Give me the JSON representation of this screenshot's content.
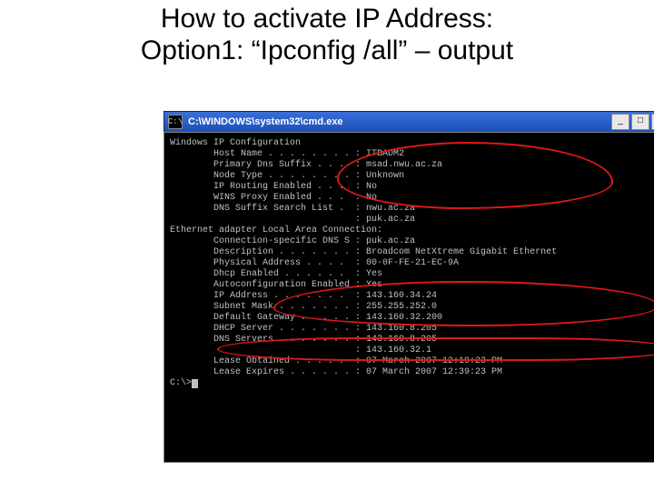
{
  "slide": {
    "title_line1": "How to activate IP Address:",
    "title_line2": "Option1: “Ipconfig /all” – output"
  },
  "window": {
    "icon_glyph": "C:\\",
    "title": "C:\\WINDOWS\\system32\\cmd.exe",
    "btn_min": "_",
    "btn_max": "□",
    "btn_close": "×"
  },
  "cmd": {
    "header": "Windows IP Configuration",
    "cfg": [
      {
        "label": "Host Name",
        "value": "ITBADM2"
      },
      {
        "label": "Primary Dns Suffix",
        "value": "msad.nwu.ac.za"
      },
      {
        "label": "Node Type",
        "value": "Unknown"
      },
      {
        "label": "IP Routing Enabled",
        "value": "No"
      },
      {
        "label": "WINS Proxy Enabled",
        "value": "No"
      },
      {
        "label": "DNS Suffix Search List",
        "value": "nwu.ac.za"
      },
      {
        "label": "",
        "value": "puk.ac.za"
      }
    ],
    "adapter_header": "Ethernet adapter Local Area Connection:",
    "adapter": [
      {
        "label": "Connection-specific DNS Suffix",
        "value": "puk.ac.za"
      },
      {
        "label": "Description",
        "value": "Broadcom NetXtreme Gigabit Ethernet"
      },
      {
        "label": "Physical Address",
        "value": "00-0F-FE-21-EC-9A"
      },
      {
        "label": "Dhcp Enabled",
        "value": "Yes"
      },
      {
        "label": "Autoconfiguration Enabled",
        "value": "Yes"
      },
      {
        "label": "IP Address",
        "value": "143.160.34.24"
      },
      {
        "label": "Subnet Mask",
        "value": "255.255.252.0"
      },
      {
        "label": "Default Gateway",
        "value": "143.160.32.200"
      },
      {
        "label": "DHCP Server",
        "value": "143.160.8.205"
      },
      {
        "label": "DNS Servers",
        "value": "143.160.8.205"
      },
      {
        "label": "",
        "value": "143.160.32.1"
      },
      {
        "label": "Lease Obtained",
        "value": "07 March 2007 12:19:23 PM"
      },
      {
        "label": "Lease Expires",
        "value": "07 March 2007 12:39:23 PM"
      }
    ],
    "prompt": "C:\\>"
  }
}
